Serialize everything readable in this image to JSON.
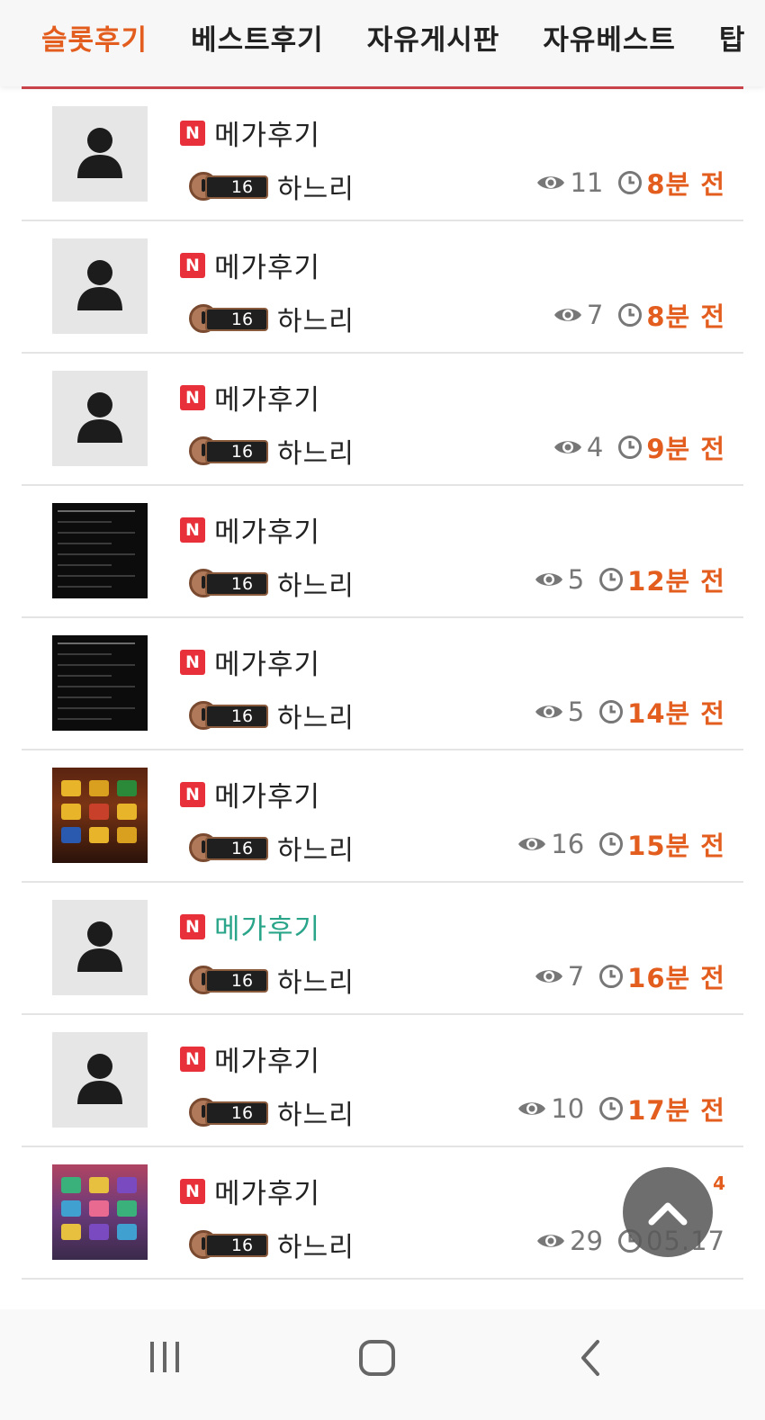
{
  "tabs": [
    {
      "label": "슬롯후기",
      "active": true
    },
    {
      "label": "베스트후기",
      "active": false
    },
    {
      "label": "자유게시판",
      "active": false
    },
    {
      "label": "자유베스트",
      "active": false
    },
    {
      "label": "탑",
      "active": false
    }
  ],
  "colors": {
    "accent": "#e35d1e",
    "new_badge": "#e8303a",
    "visited_title": "#2aa58a",
    "tab_underline": "#c9444a"
  },
  "posts": [
    {
      "badge": "N",
      "title": "메가후기",
      "level": "16",
      "author": "하느리",
      "views": "11",
      "time": "8분 전",
      "thumb": "default"
    },
    {
      "badge": "N",
      "title": "메가후기",
      "level": "16",
      "author": "하느리",
      "views": "7",
      "time": "8분 전",
      "thumb": "default"
    },
    {
      "badge": "N",
      "title": "메가후기",
      "level": "16",
      "author": "하느리",
      "views": "4",
      "time": "9분 전",
      "thumb": "default"
    },
    {
      "badge": "N",
      "title": "메가후기",
      "level": "16",
      "author": "하느리",
      "views": "5",
      "time": "12분 전",
      "thumb": "dark"
    },
    {
      "badge": "N",
      "title": "메가후기",
      "level": "16",
      "author": "하느리",
      "views": "5",
      "time": "14분 전",
      "thumb": "dark"
    },
    {
      "badge": "N",
      "title": "메가후기",
      "level": "16",
      "author": "하느리",
      "views": "16",
      "time": "15분 전",
      "thumb": "slot-orange"
    },
    {
      "badge": "N",
      "title": "메가후기",
      "level": "16",
      "author": "하느리",
      "views": "7",
      "time": "16분 전",
      "thumb": "default",
      "visited": true
    },
    {
      "badge": "N",
      "title": "메가후기",
      "level": "16",
      "author": "하느리",
      "views": "10",
      "time": "17분 전",
      "thumb": "default"
    },
    {
      "badge": "N",
      "title": "메가후기",
      "level": "16",
      "author": "하느리",
      "views": "29",
      "time": "05.17",
      "thumb": "slot-pink",
      "comments": "4"
    }
  ],
  "icons": {
    "eye": "eye-icon",
    "clock": "clock-icon",
    "user": "user-placeholder-icon",
    "scroll_top": "chevron-up-icon"
  },
  "navbar": {
    "recent": "recent-apps-icon",
    "home": "home-icon",
    "back": "back-icon"
  }
}
